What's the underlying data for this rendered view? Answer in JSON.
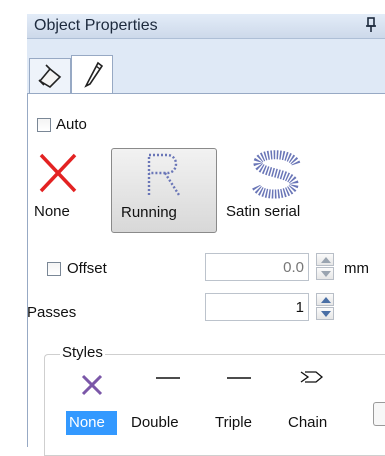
{
  "panel": {
    "title": "Object Properties"
  },
  "tabs": [
    {
      "icon": "paint-bucket-icon"
    },
    {
      "icon": "pen-icon"
    }
  ],
  "auto": {
    "label": "Auto",
    "checked": false
  },
  "stitch_types": [
    {
      "label": "None",
      "icon": "red-x-icon"
    },
    {
      "label": "Running",
      "icon": "running-stitch-r-icon",
      "selected": true
    },
    {
      "label": "Satin serial",
      "icon": "satin-s-icon"
    }
  ],
  "offset": {
    "label": "Offset",
    "checked": false,
    "value": "0.0",
    "unit": "mm"
  },
  "passes": {
    "label": "Passes",
    "value": "1"
  },
  "styles": {
    "legend": "Styles",
    "items": [
      {
        "label": "None",
        "icon": "purple-x-icon",
        "selected": true
      },
      {
        "label": "Double",
        "icon": "line-icon"
      },
      {
        "label": "Triple",
        "icon": "line-icon"
      },
      {
        "label": "Chain",
        "icon": "chain-icon"
      }
    ]
  },
  "colors": {
    "accent": "#3399ff",
    "none_x": "#e32222",
    "styles_x": "#7b57a8",
    "stitch_blue": "#6a76b7"
  }
}
